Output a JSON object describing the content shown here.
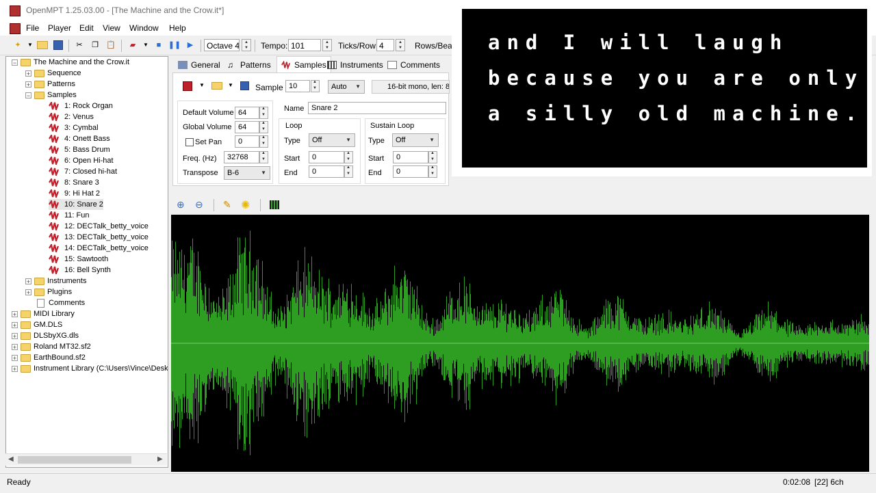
{
  "window": {
    "title": "OpenMPT 1.25.03.00 - [The Machine and the Crow.it*]"
  },
  "menu": [
    "File",
    "Player",
    "Edit",
    "View",
    "Window",
    "Help"
  ],
  "toolbar": {
    "octave": "Octave 4",
    "tempo_label": "Tempo:",
    "tempo_value": "101",
    "ticks_label": "Ticks/Row:",
    "ticks_value": "4",
    "rows_label": "Rows/Bea"
  },
  "tree": {
    "root": "The Machine and the Crow.it",
    "sequence": "Sequence",
    "patterns": "Patterns",
    "samples_folder": "Samples",
    "samples": [
      "1: Rock Organ",
      "2: Venus",
      "3: Cymbal",
      "4: Onett Bass",
      "5: Bass Drum",
      "6: Open Hi-hat",
      "7: Closed hi-hat",
      "8: Snare 3",
      "9: Hi Hat 2",
      "10: Snare 2",
      "11: Fun",
      "12: DECTalk_betty_voice",
      "13: DECTalk_betty_voice",
      "14: DECTalk_betty_voice",
      "15: Sawtooth",
      "16: Bell Synth"
    ],
    "instruments": "Instruments",
    "plugins": "Plugins",
    "comments": "Comments",
    "libraries": [
      "MIDI Library",
      "GM.DLS",
      "DLSbyXG.dls",
      "Roland MT32.sf2",
      "EarthBound.sf2",
      "Instrument Library (C:\\Users\\Vince\\Desk"
    ]
  },
  "tabs": [
    "General",
    "Patterns",
    "Samples",
    "Instruments",
    "Comments"
  ],
  "sample": {
    "sample_label": "Sample",
    "sample_number": "10",
    "mode": "Auto",
    "info": "16-bit mono, len: 8",
    "default_volume_label": "Default Volume",
    "default_volume": "64",
    "global_volume_label": "Global Volume",
    "global_volume": "64",
    "set_pan_label": "Set Pan",
    "set_pan": "0",
    "freq_label": "Freq. (Hz)",
    "freq": "32768",
    "transpose_label": "Transpose",
    "transpose": "B-6",
    "name_label": "Name",
    "name": "Snare 2",
    "loop_label": "Loop",
    "sustain_label": "Sustain Loop",
    "type_label": "Type",
    "start_label": "Start",
    "end_label": "End",
    "loop_type": "Off",
    "loop_start": "0",
    "loop_end": "0",
    "sus_type": "Off",
    "sus_start": "0",
    "sus_end": "0"
  },
  "dialog": {
    "lines": [
      "and I will laugh",
      "because you are only",
      "a silly old machine."
    ]
  },
  "status": {
    "left": "Ready",
    "time": "0:02:08",
    "info": "[22] 6ch"
  },
  "colors": {
    "waveform": "#2e9e22",
    "wave_bg": "#000000",
    "sample_icon": "#c0202a",
    "folder": "#f5d36b"
  }
}
